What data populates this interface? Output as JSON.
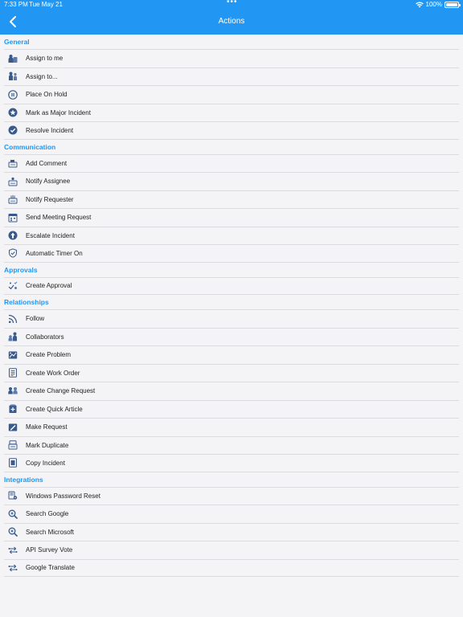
{
  "status_bar": {
    "time": "7:33 PM",
    "date": "Tue May 21",
    "battery": "100%",
    "dots": "•••"
  },
  "nav": {
    "title": "Actions"
  },
  "colors": {
    "accent": "#2196f3",
    "icon": "#3a5a8c",
    "text": "#222222"
  },
  "sections": [
    {
      "title": "General",
      "items": [
        {
          "label": "Assign to me",
          "icon": "assign-me-icon"
        },
        {
          "label": "Assign to...",
          "icon": "assign-to-icon"
        },
        {
          "label": "Place On Hold",
          "icon": "pause-icon"
        },
        {
          "label": "Mark as Major Incident",
          "icon": "star-badge-icon"
        },
        {
          "label": "Resolve Incident",
          "icon": "check-circle-icon"
        }
      ]
    },
    {
      "title": "Communication",
      "items": [
        {
          "label": "Add Comment",
          "icon": "comment-icon"
        },
        {
          "label": "Notify Assignee",
          "icon": "notify-assignee-icon"
        },
        {
          "label": "Notify Requester",
          "icon": "notify-requester-icon"
        },
        {
          "label": "Send Meeting Request",
          "icon": "calendar-icon"
        },
        {
          "label": "Escalate Incident",
          "icon": "escalate-icon"
        },
        {
          "label": "Automatic Timer On",
          "icon": "shield-check-icon"
        }
      ]
    },
    {
      "title": "Approvals",
      "items": [
        {
          "label": "Create Approval",
          "icon": "approval-icon"
        }
      ]
    },
    {
      "title": "Relationships",
      "items": [
        {
          "label": "Follow",
          "icon": "rss-icon"
        },
        {
          "label": "Collaborators",
          "icon": "collaborators-icon"
        },
        {
          "label": "Create Problem",
          "icon": "problem-icon"
        },
        {
          "label": "Create Work Order",
          "icon": "work-order-icon"
        },
        {
          "label": "Create Change Request",
          "icon": "change-request-icon"
        },
        {
          "label": "Create Quick Article",
          "icon": "quick-article-icon"
        },
        {
          "label": "Make Request",
          "icon": "make-request-icon"
        },
        {
          "label": "Mark Duplicate",
          "icon": "duplicate-icon"
        },
        {
          "label": "Copy Incident",
          "icon": "copy-icon"
        }
      ]
    },
    {
      "title": "Integrations",
      "items": [
        {
          "label": "Windows Password Reset",
          "icon": "password-reset-icon"
        },
        {
          "label": "Search Google",
          "icon": "search-icon"
        },
        {
          "label": "Search Microsoft",
          "icon": "search-icon"
        },
        {
          "label": "API Survey Vote",
          "icon": "api-icon"
        },
        {
          "label": "Google Translate",
          "icon": "api-icon"
        }
      ]
    }
  ]
}
